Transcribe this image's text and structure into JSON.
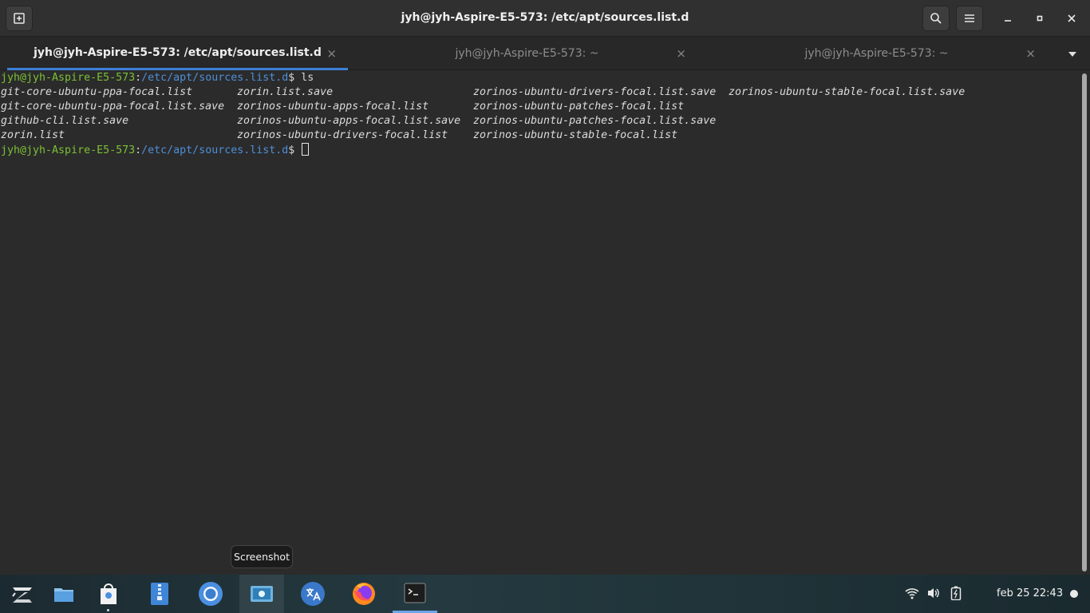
{
  "window": {
    "title": "jyh@jyh-Aspire-E5-573: /etc/apt/sources.list.d",
    "buttons": [
      "new-tab-icon",
      "search-icon",
      "menu-icon",
      "minimize-icon",
      "maximize-icon",
      "close-icon"
    ]
  },
  "tabs": [
    {
      "label": "jyh@jyh-Aspire-E5-573: /etc/apt/sources.list.d",
      "active": true,
      "close": "×"
    },
    {
      "label": "jyh@jyh-Aspire-E5-573: ~",
      "active": false,
      "close": "×"
    },
    {
      "label": "jyh@jyh-Aspire-E5-573: ~",
      "active": false,
      "close": "×"
    }
  ],
  "tab_overflow_icon": "chevron-down-icon",
  "terminal": {
    "prompt_user": "jyh@jyh-Aspire-E5-573",
    "prompt_sep": ":",
    "prompt_path": "/etc/apt/sources.list.d",
    "prompt_dollar": "$",
    "command": " ls",
    "ls_output": [
      [
        "git-core-ubuntu-ppa-focal.list",
        "git-core-ubuntu-ppa-focal.list.save",
        "github-cli.list.save",
        "zorin.list"
      ],
      [
        "zorin.list.save",
        "zorinos-ubuntu-apps-focal.list",
        "zorinos-ubuntu-apps-focal.list.save",
        "zorinos-ubuntu-drivers-focal.list"
      ],
      [
        "zorinos-ubuntu-drivers-focal.list.save",
        "zorinos-ubuntu-patches-focal.list",
        "zorinos-ubuntu-patches-focal.list.save",
        "zorinos-ubuntu-stable-focal.list"
      ],
      [
        "zorinos-ubuntu-stable-focal.list.save"
      ]
    ]
  },
  "tooltip": "Screenshot",
  "taskbar": {
    "apps": [
      "zorin-menu-icon",
      "files-icon",
      "software-store-icon",
      "archive-manager-icon",
      "chromium-icon",
      "screenshot-icon",
      "translator-icon",
      "firefox-icon",
      "terminal-icon"
    ],
    "tray": [
      "wifi-icon",
      "volume-icon",
      "battery-icon"
    ],
    "clock": "feb 25  22:43"
  },
  "colors": {
    "accent": "#3d7fd8",
    "prompt_user": "#7cc036",
    "prompt_path": "#4e8fd9",
    "terminal_bg": "#2b2b2b"
  }
}
